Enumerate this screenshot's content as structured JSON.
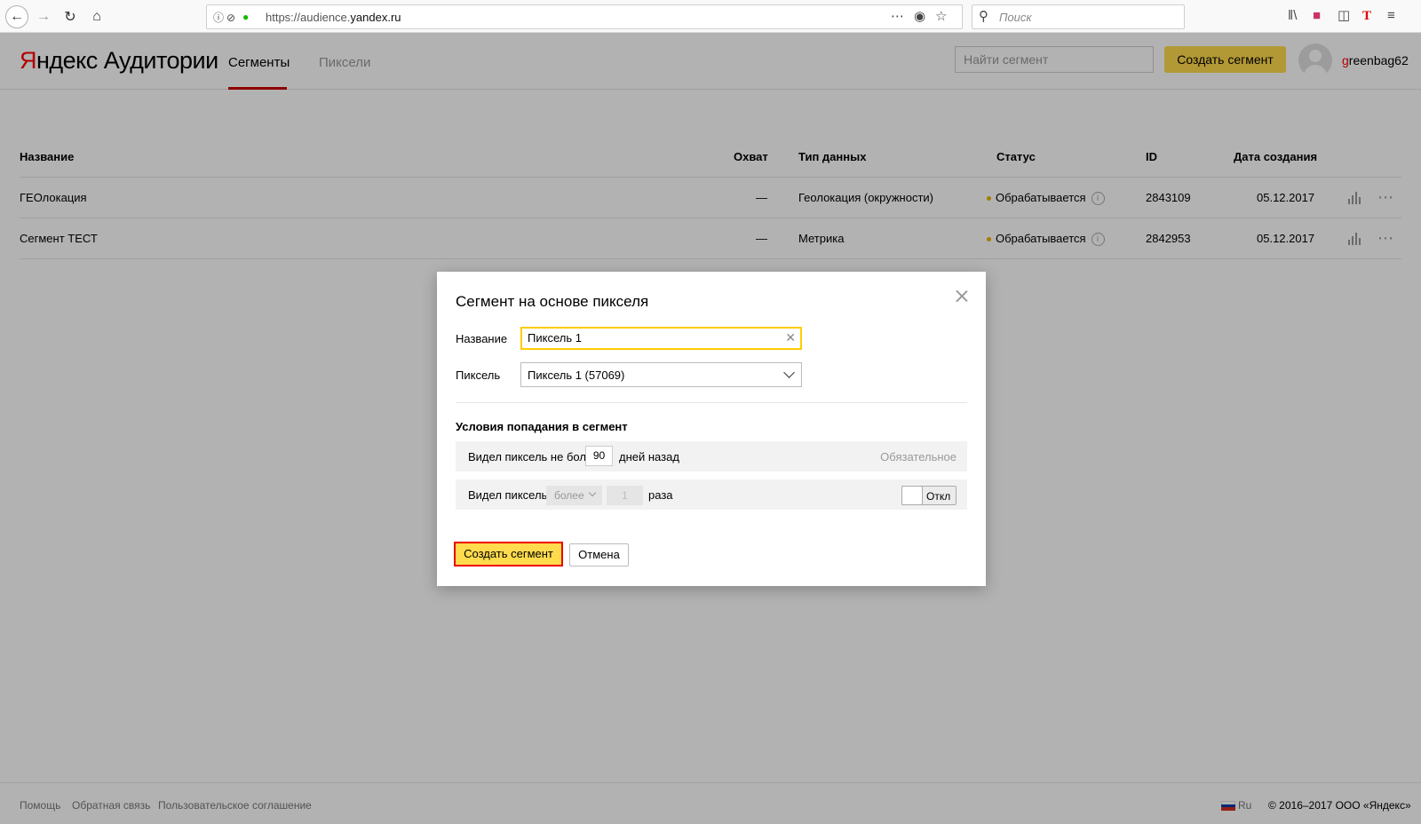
{
  "browser": {
    "url_prefix": "https://audience.",
    "url_domain": "yandex.ru",
    "search_placeholder": "Поиск"
  },
  "header": {
    "logo_first": "Я",
    "logo_rest": "ндекс Аудитории",
    "tabs": [
      {
        "label": "Сегменты",
        "active": true
      },
      {
        "label": "Пиксели",
        "active": false
      }
    ],
    "search_placeholder": "Найти сегмент",
    "create_label": "Создать сегмент",
    "user_first": "g",
    "user_rest": "reenbag62"
  },
  "table": {
    "columns": [
      "Название",
      "Охват",
      "Тип данных",
      "Статус",
      "ID",
      "Дата создания"
    ],
    "rows": [
      {
        "name": "ГЕОлокация",
        "reach": "—",
        "type": "Геолокация (окружности)",
        "status": "Обрабатывается",
        "id": "2843109",
        "date": "05.12.2017"
      },
      {
        "name": "Сегмент ТЕСТ",
        "reach": "—",
        "type": "Метрика",
        "status": "Обрабатывается",
        "id": "2842953",
        "date": "05.12.2017"
      }
    ]
  },
  "modal": {
    "title": "Сегмент на основе пикселя",
    "name_label": "Название",
    "name_value": "Пиксель 1",
    "pixel_label": "Пиксель",
    "pixel_value": "Пиксель 1 (57069)",
    "conditions_title": "Условия попадания в сегмент",
    "cond1_prefix": "Видел пиксель не более",
    "cond1_value": "90",
    "cond1_suffix": "дней назад",
    "cond1_note": "Обязательное",
    "cond2_prefix": "Видел пиксель",
    "cond2_select": "более",
    "cond2_value": "1",
    "cond2_suffix": "раза",
    "toggle_label": "Откл",
    "submit_label": "Создать сегмент",
    "cancel_label": "Отмена"
  },
  "footer": {
    "links": [
      "Помощь",
      "Обратная связь",
      "Пользовательское соглашение"
    ],
    "lang": "Ru",
    "copyright": "© 2016–2017 ООО «Яндекс»"
  },
  "colors": {
    "accent": "#ffdb4d",
    "brand_red": "#ff0000",
    "status_processing": "#f0b000"
  }
}
